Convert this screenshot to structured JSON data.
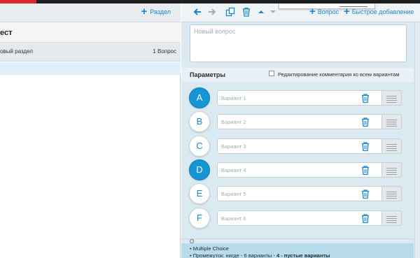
{
  "colors": {
    "accent": "#1a86c7",
    "active_option": "#1595d3",
    "brand_red": "#d9282f"
  },
  "left_panel": {
    "add_section_label": "Раздел",
    "title": "ест",
    "section": {
      "name": "овый раздел",
      "count": "1 Вопрос"
    }
  },
  "toolbar": {
    "icons": [
      "arrow-left-icon",
      "arrow-right-icon",
      "copy-icon",
      "trash-icon",
      "arrow-up-icon",
      "arrow-down-icon"
    ],
    "add_question_label": "Вопрос",
    "quick_add_label": "Быстрое добавление"
  },
  "question": {
    "placeholder": "Новый вопрос"
  },
  "params": {
    "title": "Параметры",
    "edit_comment_label": "Редактирование комментария ко всем вариантам",
    "edit_comment_checked": false
  },
  "options": [
    {
      "letter": "A",
      "placeholder": "Вариант 1",
      "active": true
    },
    {
      "letter": "B",
      "placeholder": "Вариант 2",
      "active": false
    },
    {
      "letter": "C",
      "placeholder": "Вариант 3",
      "active": false
    },
    {
      "letter": "D",
      "placeholder": "Вариант 4",
      "active": true
    },
    {
      "letter": "E",
      "placeholder": "Вариант 5",
      "active": false
    },
    {
      "letter": "F",
      "placeholder": "Вариант 6",
      "active": false
    }
  ],
  "summary": {
    "label": "О",
    "line1": "• Multiple Choice",
    "line2_prefix": "• Промежуток: нигде - 6 варианты - ",
    "line2_bold": "4 - пустые варианты"
  }
}
